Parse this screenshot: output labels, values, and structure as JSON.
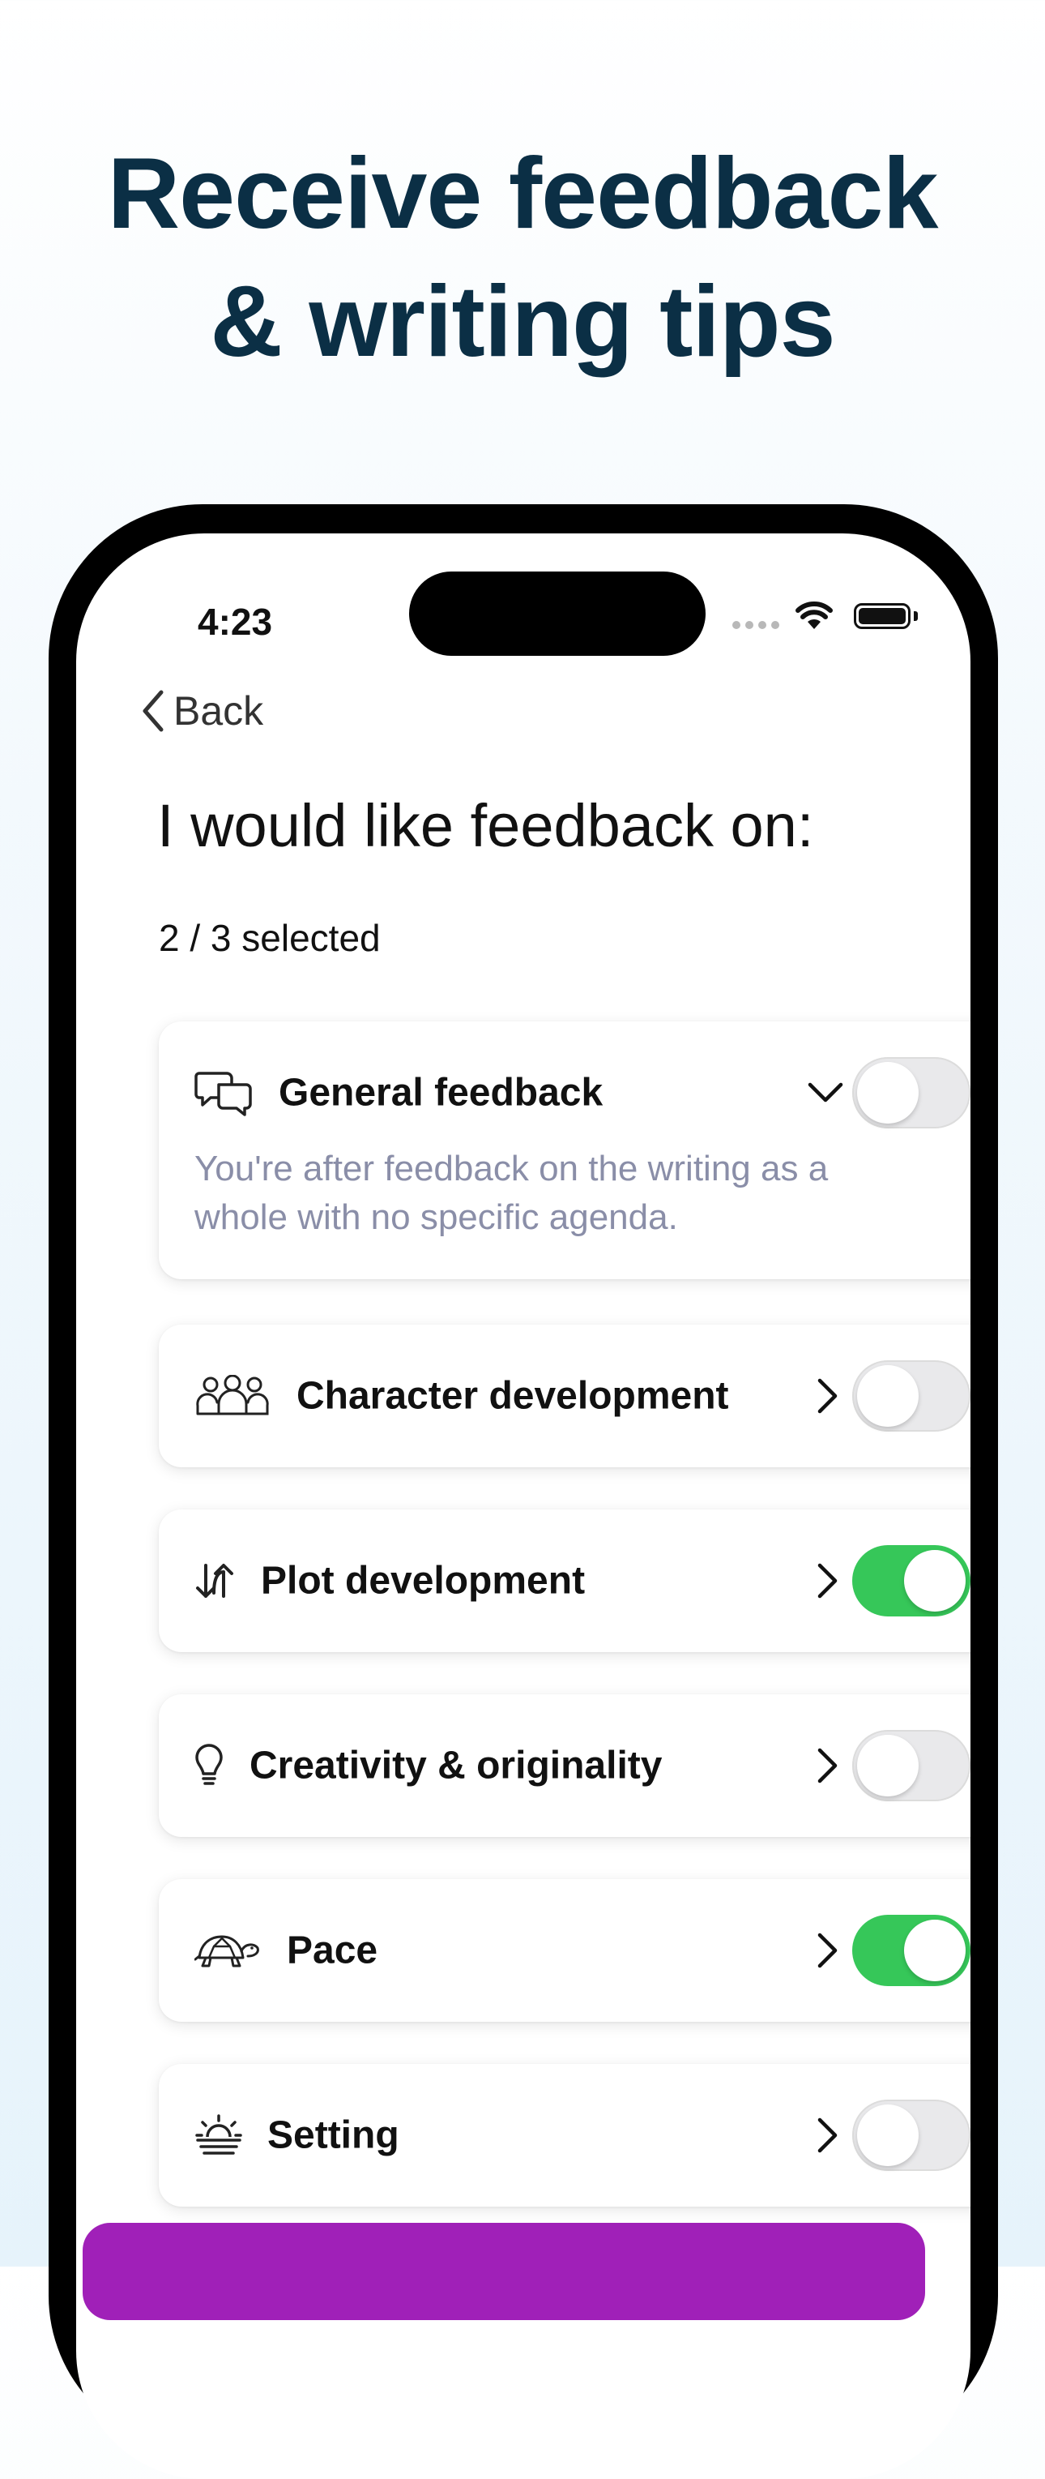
{
  "headline": {
    "line1": "Receive feedback",
    "line2": "& writing tips"
  },
  "status_bar": {
    "time": "4:23",
    "wifi_icon": "wifi-icon",
    "battery_icon": "battery-icon"
  },
  "nav": {
    "back_label": "Back",
    "back_icon": "chevron-left-icon"
  },
  "page": {
    "title": "I would like feedback on:",
    "selected_count": "2 / 3 selected"
  },
  "options": [
    {
      "label": "General feedback",
      "icon": "chat-bubbles-icon",
      "expanded": true,
      "description": "You're after feedback on the writing as a whole with no specific agenda.",
      "enabled": false
    },
    {
      "label": "Character development",
      "icon": "people-icon",
      "expanded": false,
      "enabled": false
    },
    {
      "label": "Plot development",
      "icon": "arrows-up-down-icon",
      "expanded": false,
      "enabled": true
    },
    {
      "label": "Creativity & originality",
      "icon": "lightbulb-icon",
      "expanded": false,
      "enabled": false
    },
    {
      "label": "Pace",
      "icon": "turtle-icon",
      "expanded": false,
      "enabled": true
    },
    {
      "label": "Setting",
      "icon": "sunrise-icon",
      "expanded": false,
      "enabled": false
    }
  ],
  "colors": {
    "headline": "#0b2f45",
    "toggle_on": "#36c759",
    "toggle_off": "#e9e9eb",
    "description": "#8a8ea8",
    "primary_button": "#a020b8"
  }
}
